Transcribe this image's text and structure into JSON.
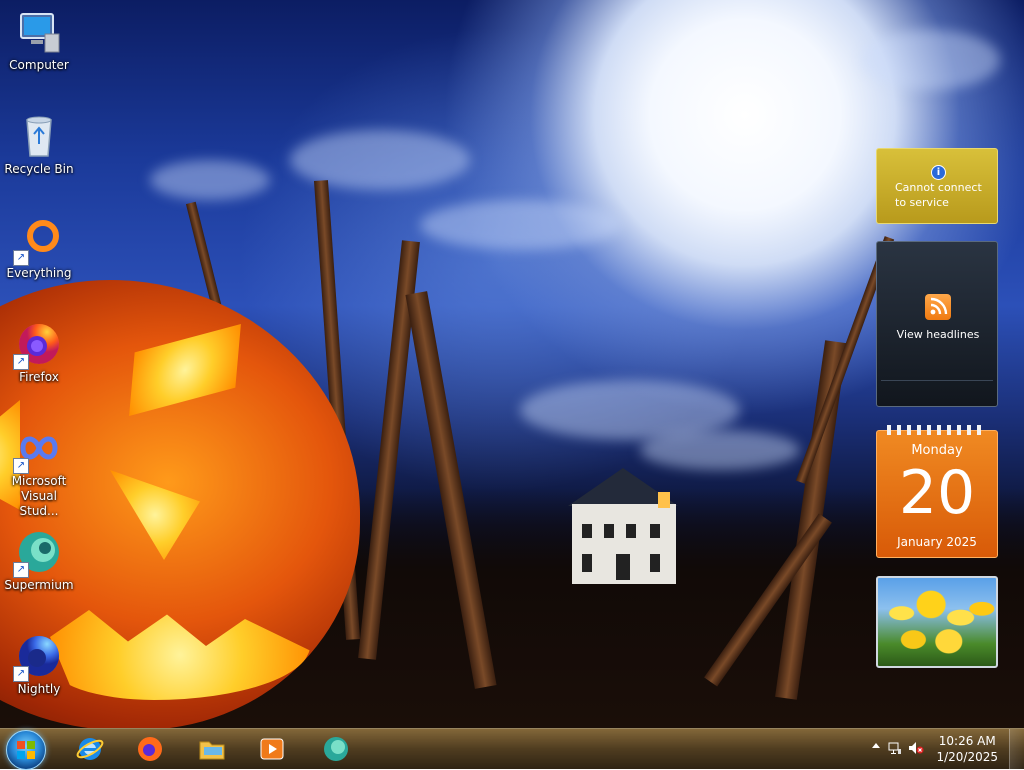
{
  "desktop": {
    "icons": [
      {
        "label": "Computer",
        "icon": "computer-icon"
      },
      {
        "label": "Recycle Bin",
        "icon": "recycle-bin-icon"
      },
      {
        "label": "Everything",
        "icon": "everything-icon"
      },
      {
        "label": "Firefox",
        "icon": "firefox-icon"
      },
      {
        "label": "Microsoft Visual Stud...",
        "icon": "visual-studio-icon"
      },
      {
        "label": "Supermium",
        "icon": "supermium-icon"
      },
      {
        "label": "Nightly",
        "icon": "firefox-nightly-icon"
      }
    ]
  },
  "gadgets": {
    "weather": {
      "message": "Cannot connect to service",
      "icon": "info-icon"
    },
    "feed": {
      "label": "View headlines",
      "icon": "rss-icon"
    },
    "calendar": {
      "weekday": "Monday",
      "day": "20",
      "month_year": "January 2025"
    },
    "slideshow": {
      "subject": "yellow tulips"
    }
  },
  "taskbar": {
    "start_icon": "windows-start-icon",
    "pinned": [
      {
        "name": "Internet Explorer",
        "icon": "internet-explorer-icon"
      },
      {
        "name": "Firefox",
        "icon": "firefox-icon"
      },
      {
        "name": "File Explorer",
        "icon": "folder-icon"
      },
      {
        "name": "Windows Media Player",
        "icon": "media-player-icon"
      },
      {
        "name": "Supermium",
        "icon": "supermium-icon"
      }
    ],
    "tray": {
      "time": "10:26 AM",
      "date": "1/20/2025",
      "icons": [
        "show-hidden-icons-icon",
        "network-icon",
        "volume-muted-icon"
      ]
    }
  },
  "colors": {
    "taskbar": "#4a3518",
    "calendar_orange": "#e8720f",
    "weather_gold": "#c9ac28",
    "feed_dark": "#1c232d"
  }
}
